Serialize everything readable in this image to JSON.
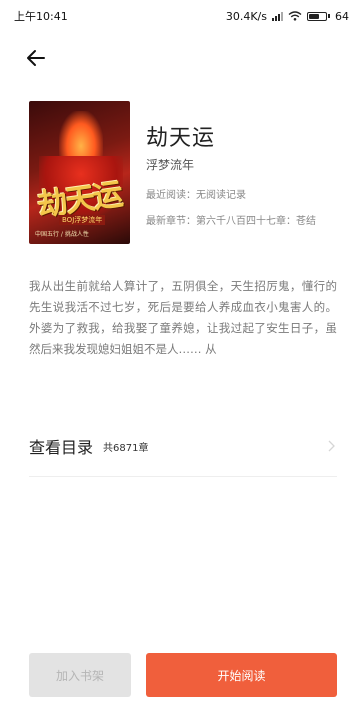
{
  "status": {
    "time": "上午10:41",
    "speed": "30.4K/s",
    "battery": "64",
    "battery_level": 0.64
  },
  "book": {
    "title": "劫天运",
    "author": "浮梦流年",
    "recent_read": "最近阅读：无阅读记录",
    "latest_chapter": "最新章节：第六千八百四十七章：苍结",
    "cover_title": "劫天运",
    "cover_author": "BOJ浮梦流年",
    "cover_bottom": "中国五行 / 挑战人性"
  },
  "description": "我从出生前就给人算计了，五阴俱全，天生招厉鬼，懂行的先生说我活不过七岁，死后是要给人养成血衣小鬼害人的。外婆为了救我，给我娶了童养媳，让我过起了安生日子，虽然后来我发现媳妇姐姐不是人…… 从",
  "catalog": {
    "label": "查看目录",
    "count": "共6871章"
  },
  "actions": {
    "add_shelf": "加入书架",
    "start_read": "开始阅读"
  },
  "colors": {
    "accent": "#f05f3c",
    "disabled_button": "#e3e3e3"
  },
  "icons": {
    "back": "arrow-left-icon",
    "catalog_chevron": "chevron-right-icon"
  }
}
